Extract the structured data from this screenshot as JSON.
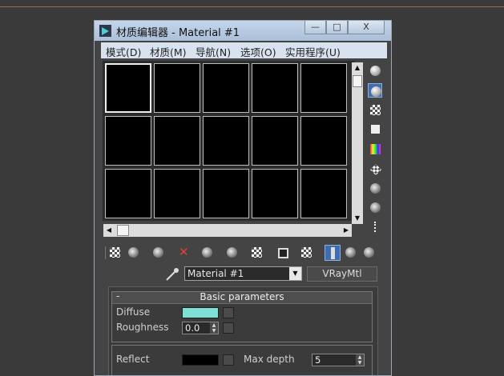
{
  "window": {
    "title": "材质编辑器 - Material #1"
  },
  "window_buttons": {
    "minimize": "—",
    "maximize": "□",
    "close": "X"
  },
  "menu": [
    "模式(D)",
    "材质(M)",
    "导航(N)",
    "选项(O)",
    "实用程序(U)"
  ],
  "material": {
    "name": "Material #1",
    "type": "VRayMtl"
  },
  "basic": {
    "title": "Basic parameters",
    "collapse": "-",
    "diffuse_label": "Diffuse",
    "diffuse_color": "#7fe0d8",
    "roughness_label": "Roughness",
    "roughness_value": "0.0",
    "reflect_label": "Reflect",
    "reflect_color": "#000000",
    "max_depth_label": "Max depth",
    "max_depth_value": "5"
  },
  "icons": {
    "side": [
      "sample-type-icon",
      "backlight-icon",
      "background-checker-icon",
      "sample-uv-icon",
      "video-color-check-icon",
      "make-preview-icon",
      "options-icon",
      "select-by-material-icon",
      "material-map-navigator-icon"
    ],
    "bottom": [
      "get-material-icon",
      "put-to-scene-icon",
      "assign-to-selection-icon",
      "reset-map-icon",
      "copy-material-icon",
      "make-unique-icon",
      "put-to-library-icon",
      "material-id-channel-icon",
      "show-shaded-in-viewport-icon",
      "show-end-result-icon",
      "go-to-parent-icon",
      "go-forward-to-sibling-icon"
    ]
  }
}
